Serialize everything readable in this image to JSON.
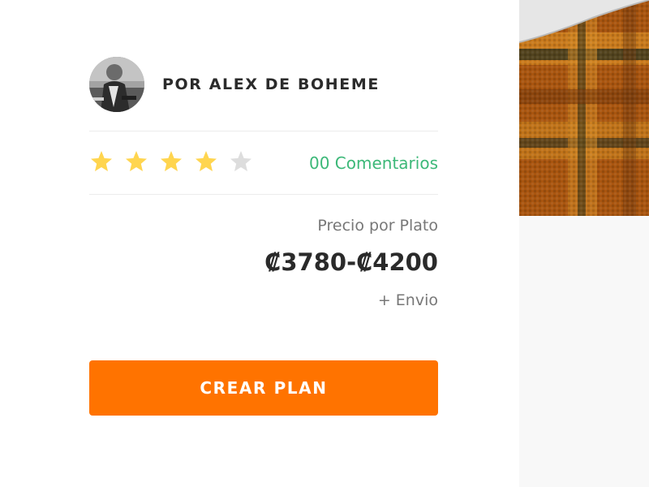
{
  "author": {
    "name": "POR ALEX DE BOHEME",
    "avatar_icon": "chef-portrait"
  },
  "rating": {
    "stars_filled": 4,
    "stars_total": 5,
    "comments_label": "00 Comentarios"
  },
  "price": {
    "label": "Precio por Plato",
    "value": "₡3780-₡4200",
    "shipping": "+ Envio"
  },
  "cta": {
    "label": "CREAR PLAN"
  },
  "colors": {
    "accent": "#ff7300",
    "link": "#3cb878",
    "star_active": "#ffd54f",
    "star_inactive": "#dddddd"
  }
}
